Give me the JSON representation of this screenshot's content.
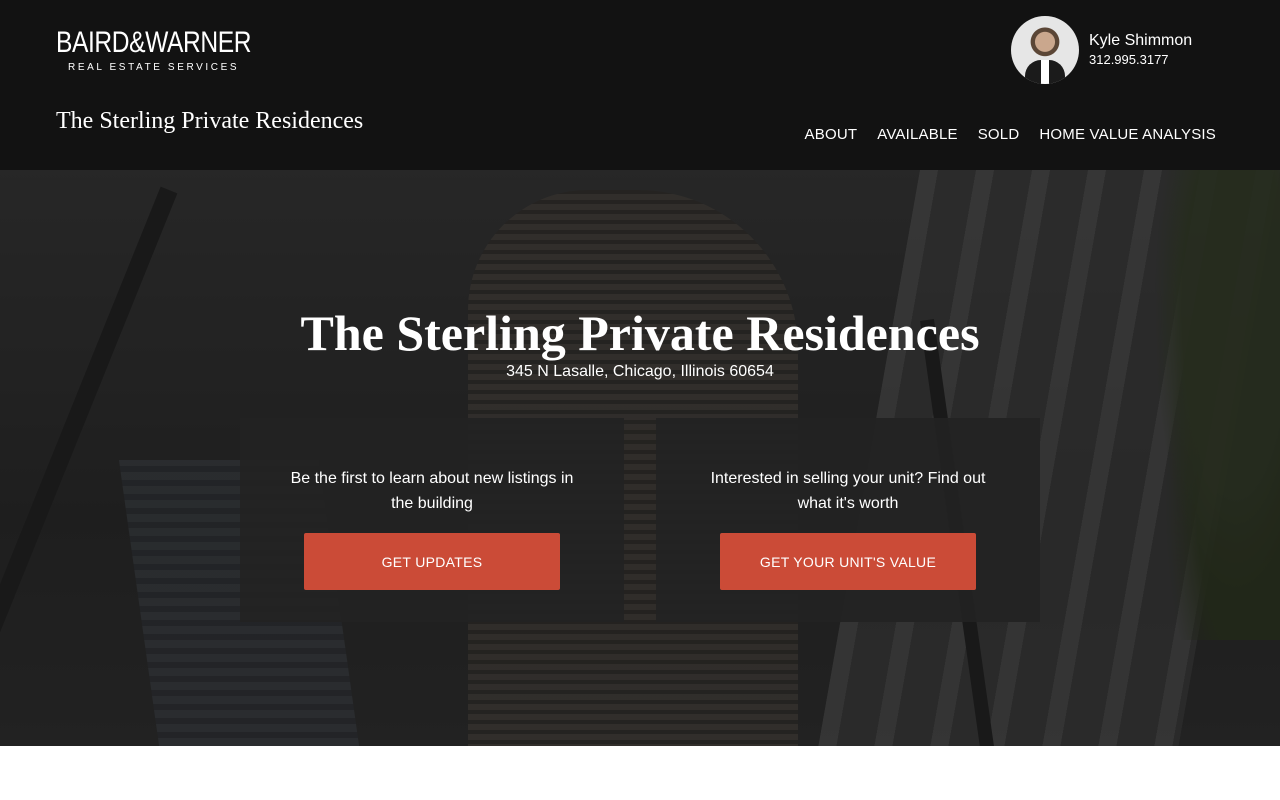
{
  "brand": {
    "logo_main": "BAIRD&WARNER",
    "logo_sub": "REAL ESTATE SERVICES",
    "site_title": "The Sterling Private Residences"
  },
  "agent": {
    "name": "Kyle Shimmon",
    "phone": "312.995.3177"
  },
  "nav": {
    "items": [
      {
        "label": "ABOUT"
      },
      {
        "label": "AVAILABLE"
      },
      {
        "label": "SOLD"
      },
      {
        "label": "HOME VALUE ANALYSIS"
      }
    ]
  },
  "hero": {
    "title": "The Sterling Private Residences",
    "address": "345 N Lasalle, Chicago, Illinois 60654"
  },
  "cta": [
    {
      "text": "Be the first to learn about new listings in the building",
      "button": "GET UPDATES"
    },
    {
      "text": "Interested in selling your unit? Find out what it's worth",
      "button": "GET YOUR UNIT'S VALUE"
    }
  ],
  "colors": {
    "header_bg": "#121212",
    "accent": "#cb4b37",
    "card_bg": "#222222"
  }
}
